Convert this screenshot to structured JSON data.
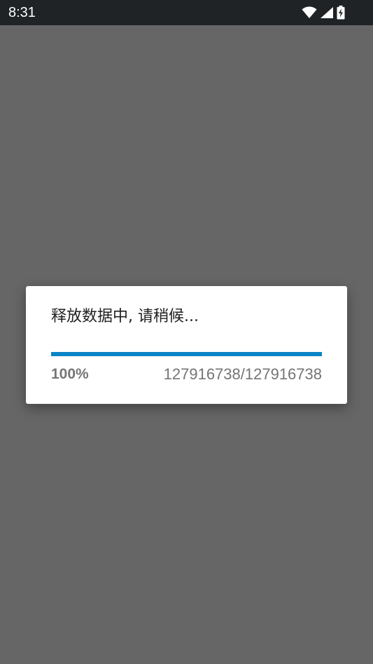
{
  "status_bar": {
    "time": "8:31",
    "icons": [
      "wifi-icon",
      "cellular-signal-icon",
      "battery-charging-icon"
    ]
  },
  "dialog": {
    "message": "释放数据中, 请稍候...",
    "progress": {
      "percent_label": "100%",
      "fraction": 1.0,
      "count_label": "127916738/127916738"
    }
  },
  "colors": {
    "scrim": "#666666",
    "status_bar": "#1f2326",
    "progress_accent": "#0a84c6",
    "secondary_text": "#757575"
  }
}
